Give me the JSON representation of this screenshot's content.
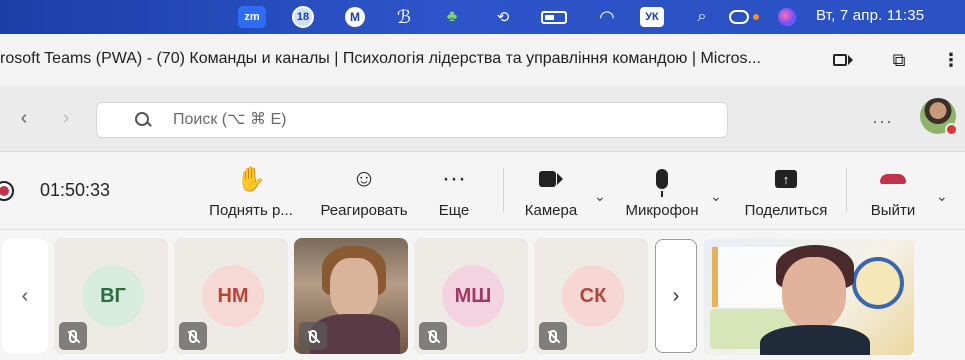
{
  "menubar": {
    "zoom_label": "zm",
    "thunderbird_badge": "18",
    "mail_label": "M",
    "keyboard_layout": "УК",
    "datetime": "Вт, 7 апр.  11:35"
  },
  "window": {
    "title": "rosoft Teams (PWA) - (70) Команды и каналы | Психологія лідерства та управління командою | Micros..."
  },
  "search": {
    "placeholder": "Поиск (⌥ ⌘ E)",
    "value": ""
  },
  "toolbar": {
    "more_label": "···"
  },
  "meeting": {
    "timer": "01:50:33",
    "controls": {
      "raise_hand": "Поднять р...",
      "react": "Реагировать",
      "more": "Еще",
      "camera": "Камера",
      "microphone": "Микрофон",
      "share": "Поделиться",
      "leave": "Выйти"
    }
  },
  "participants": [
    {
      "initials": "ВГ",
      "bg": "#d7ecdf",
      "fg": "#2f6b45"
    },
    {
      "initials": "НМ",
      "bg": "#f6d9d5",
      "fg": "#b54537"
    },
    {
      "initials": "",
      "video": true
    },
    {
      "initials": "МШ",
      "bg": "#f3d3df",
      "fg": "#a13a62"
    },
    {
      "initials": "СК",
      "bg": "#f6d7d3",
      "fg": "#b2453a"
    }
  ],
  "colors": {
    "menubar": "#2a50c2",
    "recording": "#c4314b",
    "leave": "#c4314b"
  },
  "icons": {
    "prev": "chevron-left-icon",
    "next": "chevron-right-icon"
  }
}
